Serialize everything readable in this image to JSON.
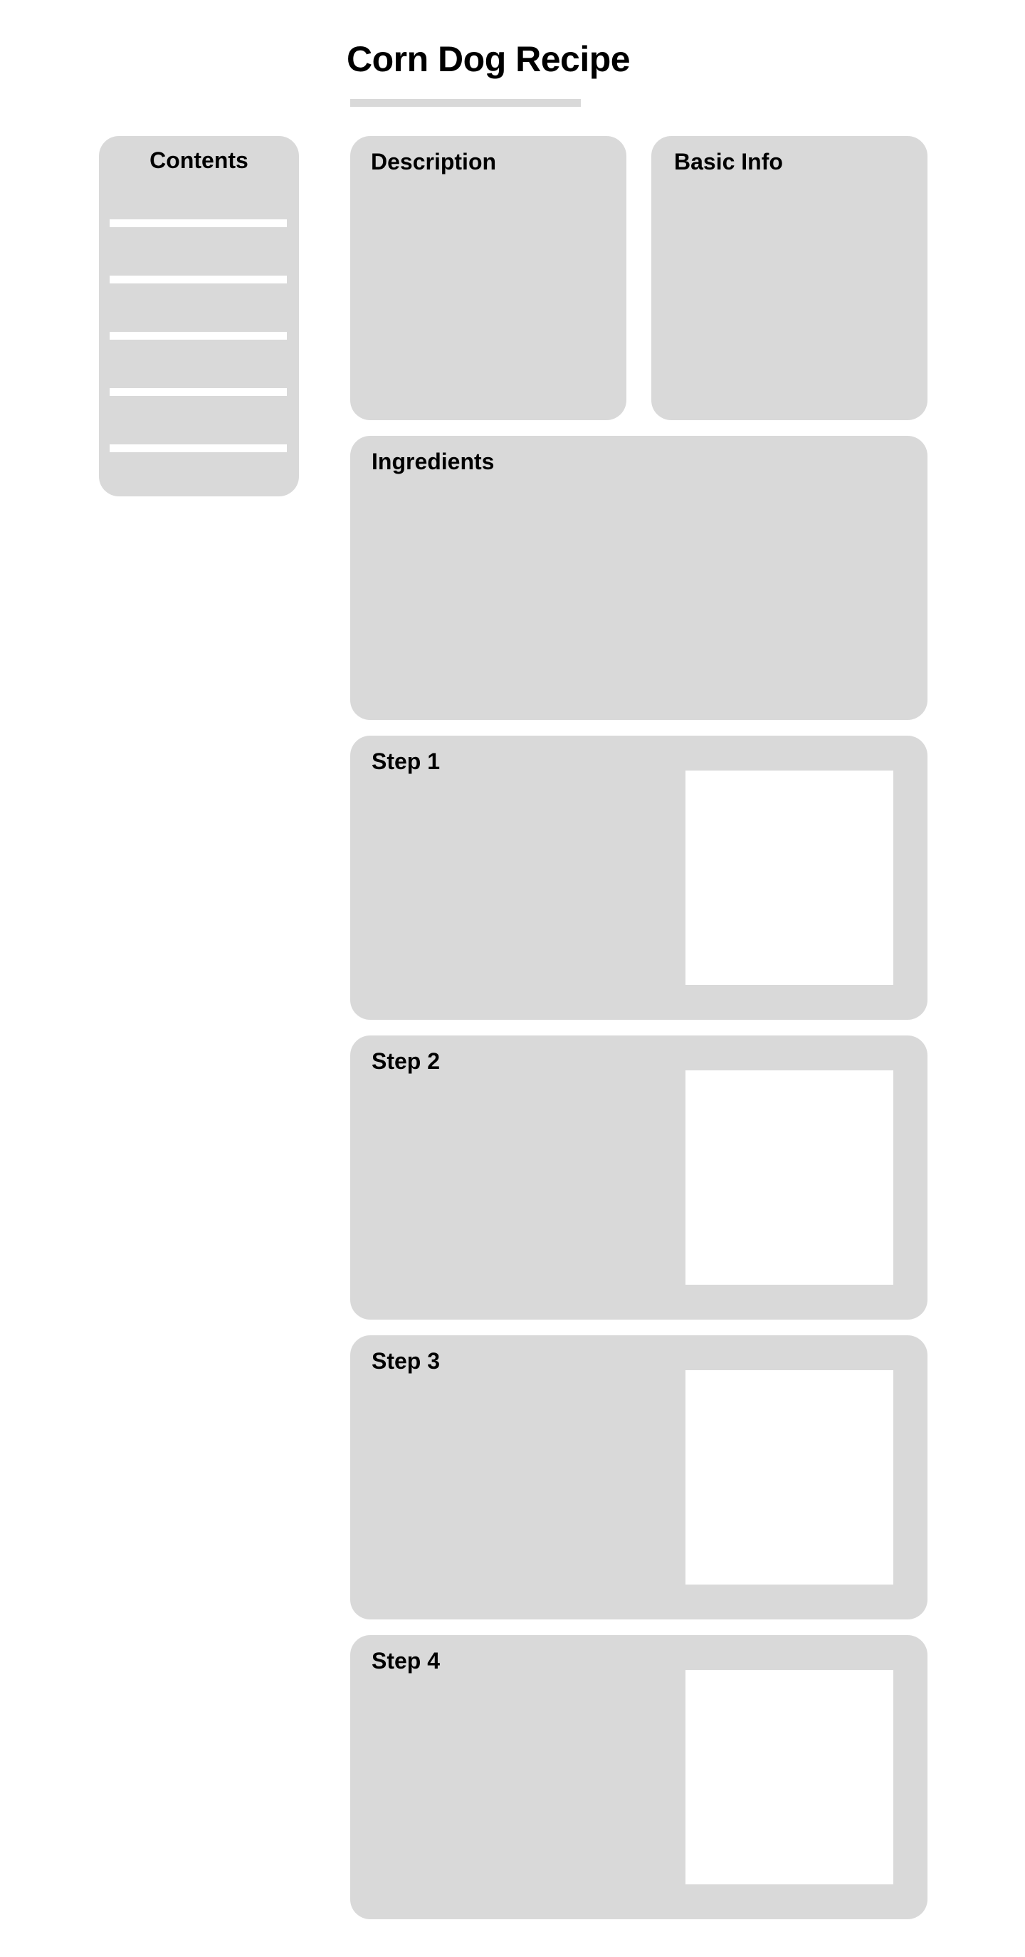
{
  "page": {
    "title": "Corn Dog Recipe"
  },
  "contents": {
    "heading": "Contents",
    "items": [
      "",
      "",
      "",
      "",
      ""
    ]
  },
  "sections": {
    "description": {
      "heading": "Description"
    },
    "basic_info": {
      "heading": "Basic Info"
    },
    "ingredients": {
      "heading": "Ingredients"
    },
    "steps": [
      {
        "heading": "Step 1"
      },
      {
        "heading": "Step 2"
      },
      {
        "heading": "Step 3"
      },
      {
        "heading": "Step 4"
      }
    ]
  },
  "colors": {
    "card_background": "#d9d9d9",
    "image_placeholder": "#ffffff",
    "text": "#000000",
    "page_background": "#ffffff"
  }
}
